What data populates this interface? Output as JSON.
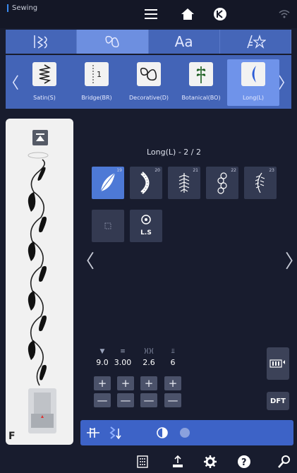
{
  "header": {
    "title": "Sewing"
  },
  "category_tabs": [
    {
      "icon": "utility-stitch-icon"
    },
    {
      "icon": "decorative-stitch-icon",
      "active": true
    },
    {
      "label": "Aa"
    },
    {
      "icon": "favorite-stitch-icon"
    }
  ],
  "stitch_categories": [
    {
      "label": "Satin(S)"
    },
    {
      "label": "Bridge(BR)"
    },
    {
      "label": "Decorative(D)"
    },
    {
      "label": "Botanical(BO)"
    },
    {
      "label": "Long(L)",
      "active": true
    }
  ],
  "page": {
    "title": "Long(L) - 2 / 2"
  },
  "stitches": [
    {
      "number": "19",
      "selected": true
    },
    {
      "number": "20"
    },
    {
      "number": "21"
    },
    {
      "number": "22"
    },
    {
      "number": "23"
    }
  ],
  "ls_button": {
    "label": "L.S"
  },
  "parameters": [
    {
      "icon": "width-icon",
      "value": "9.0"
    },
    {
      "icon": "length-icon",
      "value": "3.00"
    },
    {
      "icon": "density-icon",
      "value": "2.6"
    },
    {
      "icon": "tension-icon",
      "value": "6"
    }
  ],
  "controls": {
    "plus": "+",
    "minus": "—",
    "dft_label": "DFT"
  },
  "preview": {
    "foot_letter": "F"
  },
  "colors": {
    "background": "#181c2e",
    "tab_bar": "#4566b8",
    "selected": "#4d79d6",
    "tool_row": "#3d63c7"
  }
}
